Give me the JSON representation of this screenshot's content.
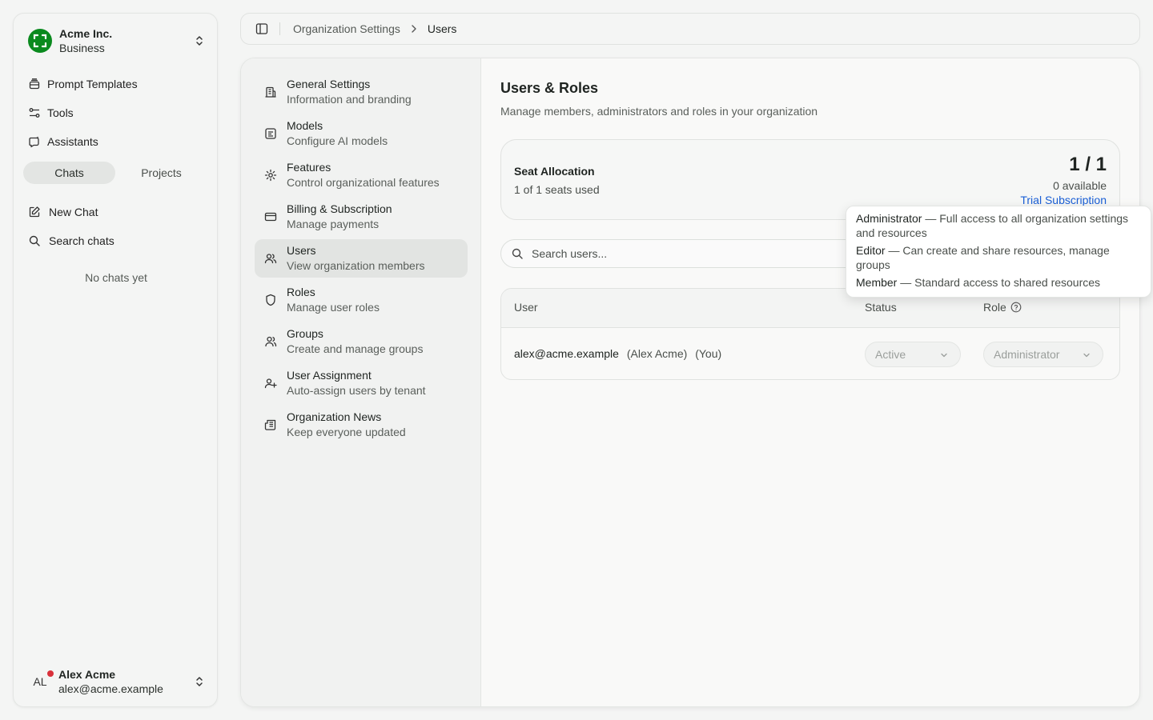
{
  "org": {
    "name": "Acme Inc.",
    "plan": "Business",
    "logo_color": "#0a8a1e"
  },
  "nav": {
    "items": [
      {
        "label": "Prompt Templates",
        "icon": "prompt-templates-icon"
      },
      {
        "label": "Tools",
        "icon": "tools-icon"
      },
      {
        "label": "Assistants",
        "icon": "assistants-icon"
      }
    ]
  },
  "segment": {
    "chats": "Chats",
    "projects": "Projects",
    "active": "Chats"
  },
  "chat_actions": {
    "new_chat": "New Chat",
    "search_chats": "Search chats",
    "empty": "No chats yet"
  },
  "user": {
    "initials": "AL",
    "name": "Alex Acme",
    "email": "alex@acme.example",
    "status_color": "#d9313b"
  },
  "breadcrumb": {
    "parent": "Organization Settings",
    "current": "Users"
  },
  "settings_nav": [
    {
      "title": "General Settings",
      "subtitle": "Information and branding",
      "icon": "building-icon"
    },
    {
      "title": "Models",
      "subtitle": "Configure AI models",
      "icon": "model-icon"
    },
    {
      "title": "Features",
      "subtitle": "Control organizational features",
      "icon": "gear-icon"
    },
    {
      "title": "Billing & Subscription",
      "subtitle": "Manage payments",
      "icon": "credit-card-icon"
    },
    {
      "title": "Users",
      "subtitle": "View organization members",
      "icon": "users-icon",
      "active": true
    },
    {
      "title": "Roles",
      "subtitle": "Manage user roles",
      "icon": "shield-icon"
    },
    {
      "title": "Groups",
      "subtitle": "Create and manage groups",
      "icon": "groups-icon"
    },
    {
      "title": "User Assignment",
      "subtitle": "Auto-assign users by tenant",
      "icon": "user-plus-icon"
    },
    {
      "title": "Organization News",
      "subtitle": "Keep everyone updated",
      "icon": "newspaper-icon"
    }
  ],
  "page": {
    "title": "Users & Roles",
    "description": "Manage members, administrators and roles in your organization"
  },
  "seats": {
    "label": "Seat Allocation",
    "used_text": "1 of 1 seats used",
    "count": "1 / 1",
    "available": "0 available",
    "subscription": "Trial Subscription",
    "link_color": "#1a5fd6"
  },
  "search": {
    "placeholder": "Search users..."
  },
  "table": {
    "headers": {
      "user": "User",
      "status": "Status",
      "role": "Role"
    },
    "rows": [
      {
        "email": "alex@acme.example",
        "name": "(Alex Acme)",
        "you": "(You)",
        "status": "Active",
        "role": "Administrator"
      }
    ]
  },
  "tooltip": {
    "items": [
      {
        "role": "Administrator",
        "desc": " — Full access to all organization settings and resources"
      },
      {
        "role": "Editor",
        "desc": " — Can create and share resources, manage groups"
      },
      {
        "role": "Member",
        "desc": " — Standard access to shared resources"
      }
    ]
  }
}
